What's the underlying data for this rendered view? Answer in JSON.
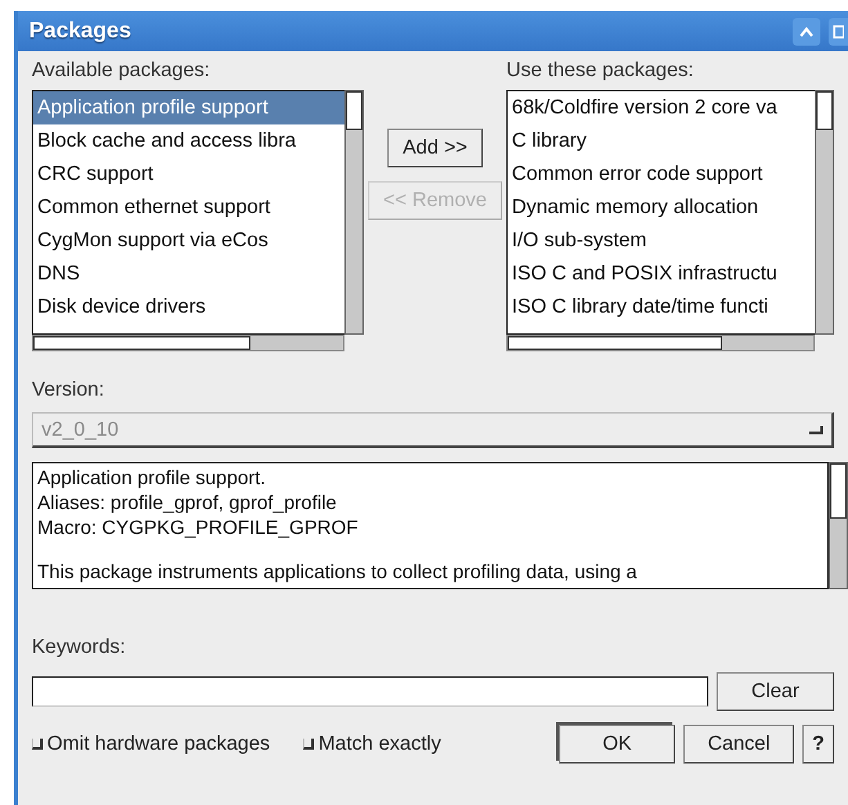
{
  "window": {
    "title": "Packages"
  },
  "available": {
    "label": "Available packages:",
    "items": [
      {
        "text": "Application profile support",
        "selected": true
      },
      {
        "text": "Block cache and access libra",
        "selected": false
      },
      {
        "text": "CRC support",
        "selected": false
      },
      {
        "text": "Common ethernet support",
        "selected": false
      },
      {
        "text": "CygMon support via eCos",
        "selected": false
      },
      {
        "text": "DNS",
        "selected": false
      },
      {
        "text": "Disk device drivers",
        "selected": false
      }
    ]
  },
  "move_buttons": [
    {
      "label": "Add >>",
      "disabled": false
    },
    {
      "label": "<< Remove",
      "disabled": true
    }
  ],
  "used": {
    "label": "Use these packages:",
    "items": [
      {
        "text": "68k/Coldfire version 2 core va",
        "selected": false
      },
      {
        "text": "C library",
        "selected": false
      },
      {
        "text": "Common error code support",
        "selected": false
      },
      {
        "text": "Dynamic memory allocation",
        "selected": false
      },
      {
        "text": "I/O sub-system",
        "selected": false
      },
      {
        "text": "ISO C and POSIX infrastructu",
        "selected": false
      },
      {
        "text": "ISO C library date/time functi",
        "selected": false
      }
    ]
  },
  "version": {
    "label": "Version:",
    "value": "v2_0_10",
    "disabled": true
  },
  "description": {
    "lines": [
      "Application profile support.",
      "Aliases: profile_gprof, gprof_profile",
      "Macro: CYGPKG_PROFILE_GPROF"
    ],
    "paragraph": "This package instruments applications to collect profiling data, using a"
  },
  "keywords": {
    "label": "Keywords:",
    "clear": "Clear"
  },
  "options": [
    {
      "label": "Omit hardware packages",
      "checked": false
    },
    {
      "label": "Match exactly",
      "checked": false
    }
  ],
  "dialog_buttons": [
    {
      "label": "OK",
      "default": true
    },
    {
      "label": "Cancel",
      "default": false
    },
    {
      "label": "?",
      "default": false
    }
  ]
}
